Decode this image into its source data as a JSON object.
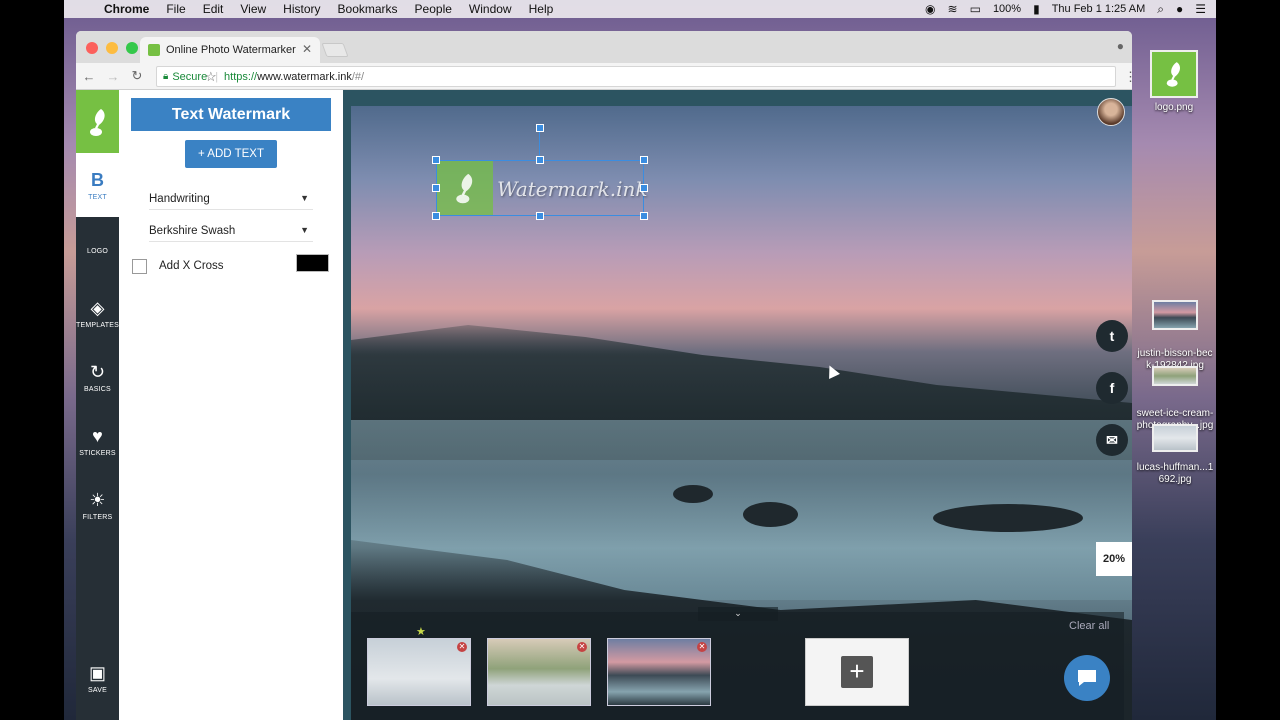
{
  "menubar": {
    "app": "Chrome",
    "items": [
      "File",
      "Edit",
      "View",
      "History",
      "Bookmarks",
      "People",
      "Window",
      "Help"
    ],
    "battery": "100%",
    "clock": "Thu Feb 1  1:25 AM"
  },
  "browser": {
    "tab_title": "Online Photo Watermarker",
    "secure_label": "Secure",
    "url_scheme": "https://",
    "url_host": "www.watermark.ink",
    "url_path": "/#/"
  },
  "sidebar": {
    "items": [
      {
        "label": "TEXT",
        "icon": "bold-text-icon"
      },
      {
        "label": "LOGO",
        "icon": "apple-logo-icon"
      },
      {
        "label": "TEMPLATES",
        "icon": "layers-icon"
      },
      {
        "label": "BASICS",
        "icon": "rotate-icon"
      },
      {
        "label": "STICKERS",
        "icon": "heart-icon"
      },
      {
        "label": "FILTERS",
        "icon": "brightness-icon"
      }
    ],
    "save_label": "SAVE"
  },
  "panel": {
    "title": "Text Watermark",
    "add_text_label": "+ ADD TEXT",
    "category_select": "Handwriting",
    "font_select": "Berkshire Swash",
    "cross_label": "Add X Cross",
    "cross_color": "#000000"
  },
  "canvas": {
    "watermark_text": "Watermark.ink",
    "zoom": "20%",
    "clear_all": "Clear all",
    "tray_toggle": "⌄"
  },
  "desktop": {
    "icons": [
      {
        "label": "logo.png"
      },
      {
        "label": "justin-bisson-beck-192842.jpg"
      },
      {
        "label": "sweet-ice-cream-photography...jpg"
      },
      {
        "label": "lucas-huffman...1692.jpg"
      }
    ]
  },
  "colors": {
    "brand_green": "#76c043",
    "accent_blue": "#3a82c4",
    "sidebar_dark": "#262f36"
  }
}
